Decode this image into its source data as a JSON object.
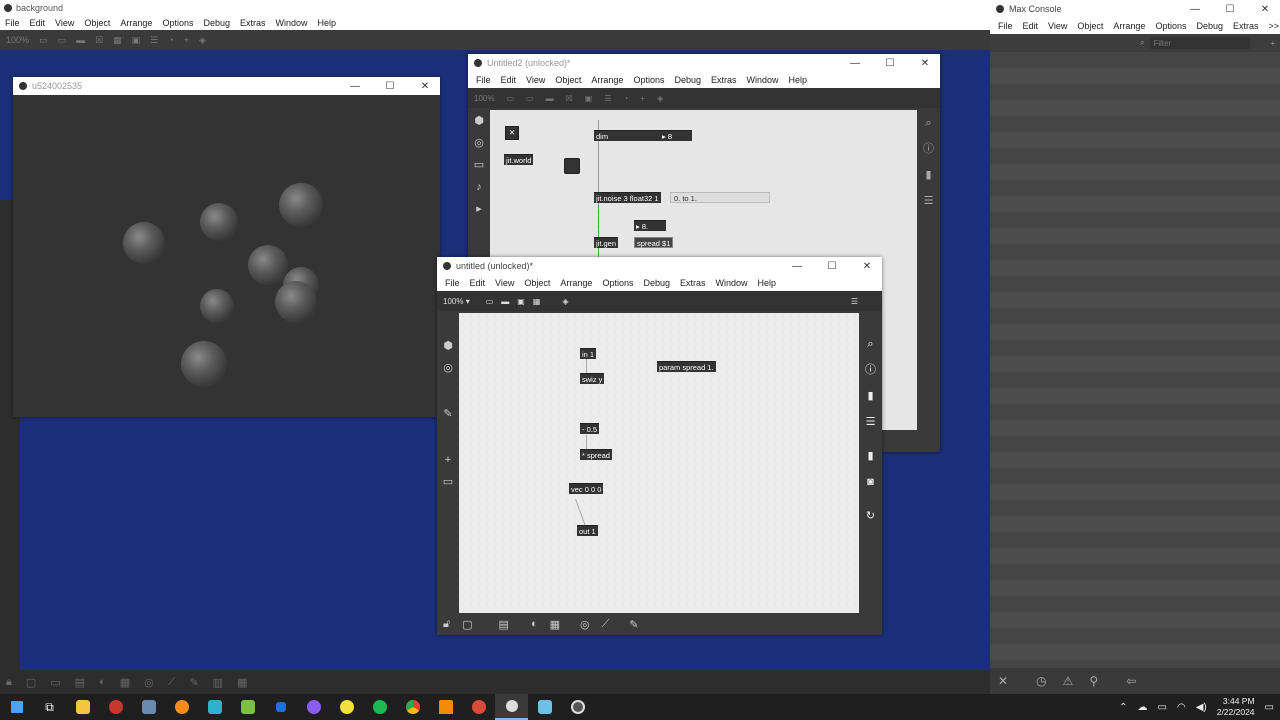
{
  "background_window": {
    "title": "background",
    "menu": [
      "File",
      "Edit",
      "View",
      "Object",
      "Arrange",
      "Options",
      "Debug",
      "Extras",
      "Window",
      "Help"
    ],
    "zoom": "100%"
  },
  "render_window": {
    "title": "u524002535"
  },
  "untitled2": {
    "title": "Untitled2 (unlocked)*",
    "menu": [
      "File",
      "Edit",
      "View",
      "Object",
      "Arrange",
      "Options",
      "Debug",
      "Extras",
      "Window",
      "Help"
    ],
    "zoom": "100%",
    "objects": {
      "dim": "dim",
      "dim_value": "8",
      "world": "jit.world",
      "noise": "jit.noise 3 float32 1",
      "range": "0. to 1.",
      "number": "8.",
      "gen": "jit.gen",
      "spread": "spread $1"
    }
  },
  "untitled": {
    "title": "untitled (unlocked)*",
    "menu": [
      "File",
      "Edit",
      "View",
      "Object",
      "Arrange",
      "Options",
      "Debug",
      "Extras",
      "Window",
      "Help"
    ],
    "zoom": "100%",
    "objects": {
      "in1": "in 1",
      "swiz": "swiz y",
      "minus": "- 0.5",
      "times": "* spread",
      "vec": "vec 0 0 0",
      "out1": "out 1",
      "param": "param spread 1."
    }
  },
  "console": {
    "title": "Max Console",
    "menu": [
      "File",
      "Edit",
      "View",
      "Object",
      "Arrange",
      "Options",
      "Debug",
      "Extras",
      ">>"
    ],
    "filter_placeholder": "Filter"
  },
  "taskbar": {
    "time": "3:44 PM",
    "date": "2/22/2024"
  }
}
